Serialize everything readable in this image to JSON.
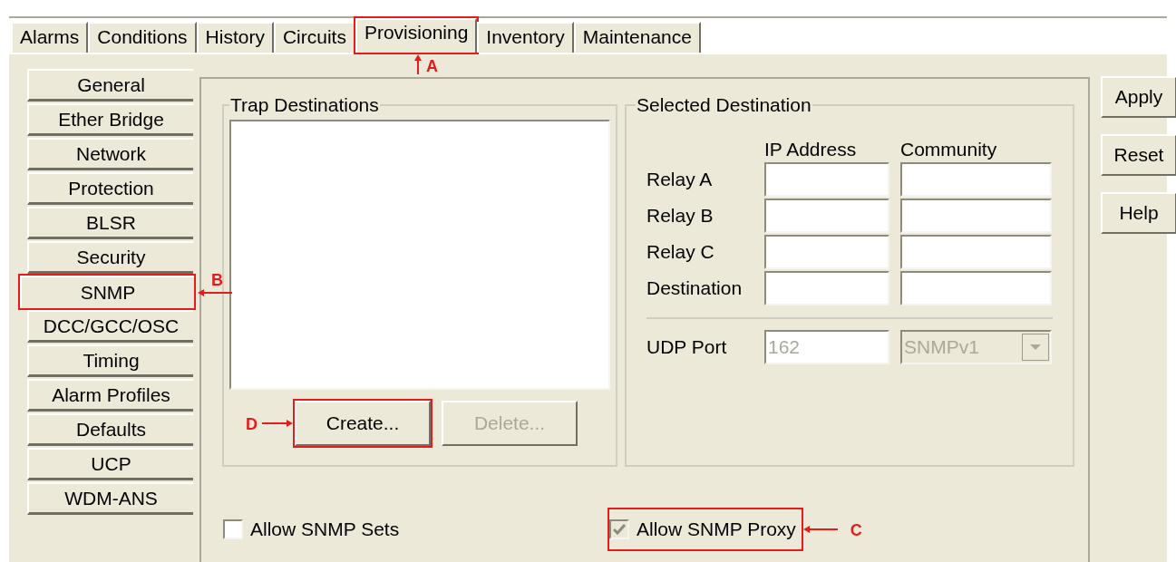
{
  "tabs": [
    {
      "label": "Alarms",
      "selected": false
    },
    {
      "label": "Conditions",
      "selected": false
    },
    {
      "label": "History",
      "selected": false
    },
    {
      "label": "Circuits",
      "selected": false
    },
    {
      "label": "Provisioning",
      "selected": true,
      "callout": "A"
    },
    {
      "label": "Inventory",
      "selected": false
    },
    {
      "label": "Maintenance",
      "selected": false
    }
  ],
  "sidebar": {
    "items": [
      {
        "label": "General",
        "selected": false
      },
      {
        "label": "Ether Bridge",
        "selected": false
      },
      {
        "label": "Network",
        "selected": false
      },
      {
        "label": "Protection",
        "selected": false
      },
      {
        "label": "BLSR",
        "selected": false
      },
      {
        "label": "Security",
        "selected": false
      },
      {
        "label": "SNMP",
        "selected": true,
        "callout": "B"
      },
      {
        "label": "DCC/GCC/OSC",
        "selected": false
      },
      {
        "label": "Timing",
        "selected": false
      },
      {
        "label": "Alarm Profiles",
        "selected": false
      },
      {
        "label": "Defaults",
        "selected": false
      },
      {
        "label": "UCP",
        "selected": false
      },
      {
        "label": "WDM-ANS",
        "selected": false
      }
    ]
  },
  "trap_destinations": {
    "title": "Trap Destinations",
    "buttons": [
      {
        "label": "Create...",
        "disabled": false,
        "callout": "D"
      },
      {
        "label": "Delete...",
        "disabled": true
      }
    ]
  },
  "selected_destination": {
    "title": "Selected Destination",
    "columns": [
      "IP Address",
      "Community"
    ],
    "rows": [
      {
        "label": "Relay A"
      },
      {
        "label": "Relay B"
      },
      {
        "label": "Relay C"
      },
      {
        "label": "Destination"
      }
    ],
    "udp_port": {
      "label": "UDP Port",
      "value": "162",
      "disabled": true
    },
    "version": {
      "value": "SNMPv1",
      "disabled": true
    }
  },
  "options": [
    {
      "label": "Allow SNMP Sets",
      "checked": false,
      "disabled": false
    },
    {
      "label": "Allow SNMP Proxy",
      "checked": true,
      "disabled": true,
      "callout": "C"
    }
  ],
  "side_buttons": [
    "Apply",
    "Reset",
    "Help"
  ]
}
